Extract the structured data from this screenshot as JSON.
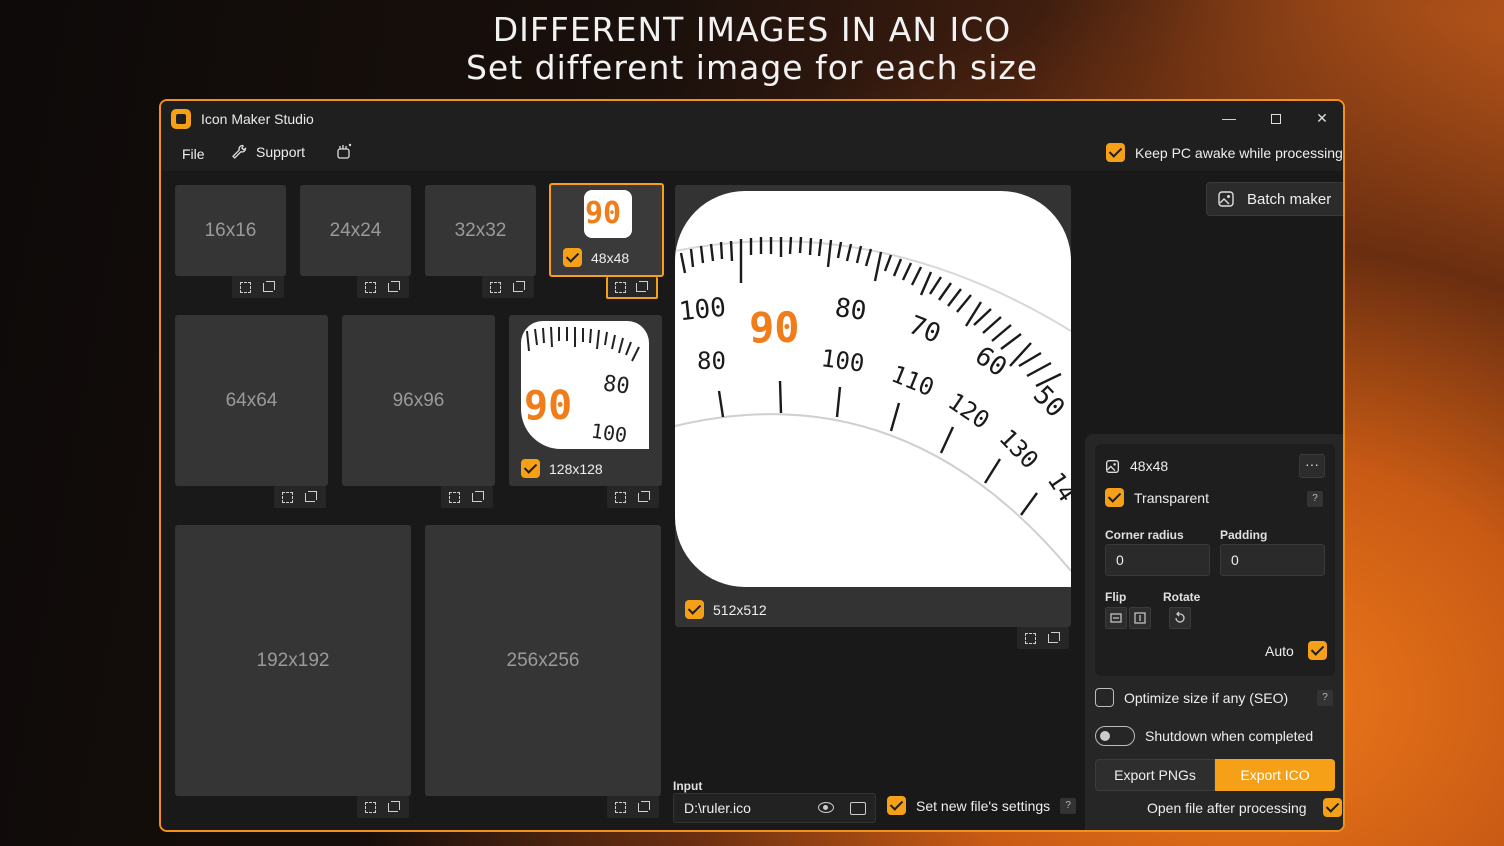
{
  "headline": {
    "line1": "DIFFERENT IMAGES IN AN ICO",
    "line2": "Set different image for each size"
  },
  "window": {
    "title": "Icon Maker Studio",
    "min_glyph": "—",
    "close_glyph": "✕"
  },
  "menu": {
    "file": "File",
    "support": "Support",
    "keep_awake": "Keep PC awake while processing"
  },
  "tiles": {
    "t16": "16x16",
    "t24": "24x24",
    "t32": "32x32",
    "t48": "48x48",
    "t64": "64x64",
    "t96": "96x96",
    "t128": "128x128",
    "t192": "192x192",
    "t256": "256x256",
    "t512": "512x512"
  },
  "thumb_numbers": {
    "n90": "90",
    "n80": "80",
    "n100": "100",
    "n70": "70",
    "n60": "60",
    "n50": "50",
    "n110": "110",
    "n120": "120",
    "n130": "130",
    "n140": "14"
  },
  "batch_maker": "Batch maker",
  "settings": {
    "size": "48x48",
    "more": "···",
    "transparent": "Transparent",
    "help": "?",
    "corner_radius_label": "Corner radius",
    "corner_radius": "0",
    "padding_label": "Padding",
    "padding": "0",
    "flip_label": "Flip",
    "rotate_label": "Rotate",
    "auto": "Auto"
  },
  "options": {
    "optimize": "Optimize size if any (SEO)",
    "shutdown": "Shutdown when completed",
    "export_pngs": "Export PNGs",
    "export_ico": "Export ICO",
    "open_after": "Open file after processing"
  },
  "input": {
    "label": "Input",
    "value": "D:\\ruler.ico",
    "set_new": "Set new file's settings"
  },
  "colors": {
    "accent": "#f5a017",
    "ruler_orange": "#f07d1a"
  }
}
